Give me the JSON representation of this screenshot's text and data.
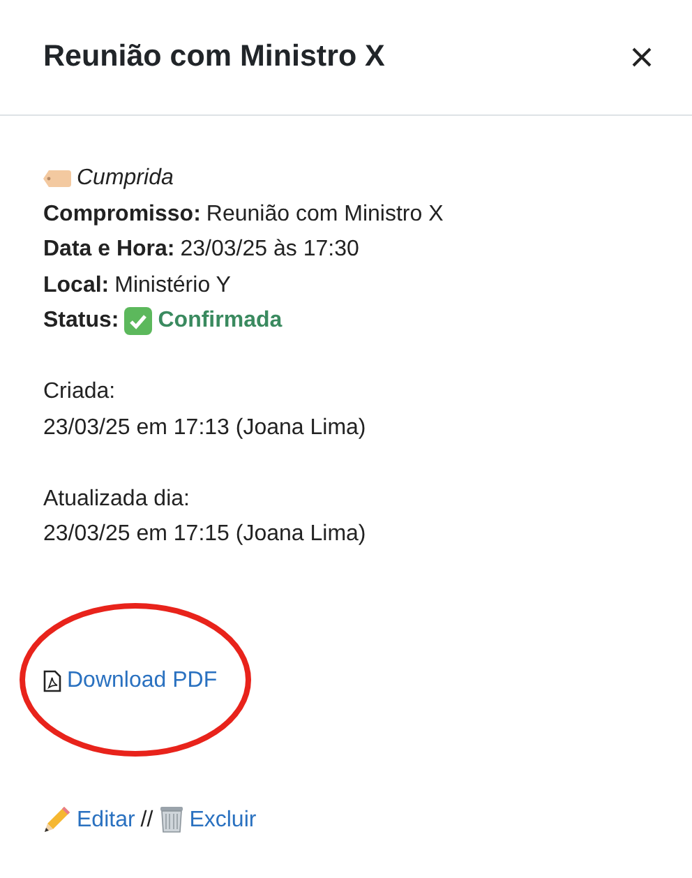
{
  "dialog": {
    "title": "Reunião com Ministro X"
  },
  "tag": {
    "label": "Cumprida"
  },
  "details": [
    {
      "kind": "plain",
      "label": "Compromisso:",
      "value": "Reunião com Ministro X"
    },
    {
      "kind": "plain",
      "label": "Data e Hora:",
      "value": "23/03/25 às 17:30"
    },
    {
      "kind": "plain",
      "label": "Local:",
      "value": "Ministério Y"
    },
    {
      "kind": "status",
      "label": "Status:",
      "value": "Confirmada",
      "color": "#3a8a5f"
    }
  ],
  "history": [
    {
      "label": "Criada:",
      "value": "23/03/25 em 17:13 (Joana Lima)"
    },
    {
      "label": "Atualizada dia:",
      "value": "23/03/25 em 17:15 (Joana Lima)"
    }
  ],
  "download": {
    "label": "Download PDF",
    "highlighted": true
  },
  "actions": [
    {
      "kind": "edit",
      "label": "Editar"
    },
    {
      "kind": "delete",
      "label": "Excluir"
    }
  ],
  "separator": "//"
}
